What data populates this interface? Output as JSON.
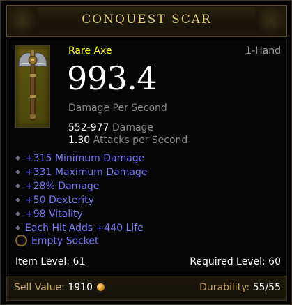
{
  "title": "CONQUEST SCAR",
  "item": {
    "type": "Rare Axe",
    "slot": "1-Hand",
    "icon": "axe-icon",
    "dps": "993.4",
    "dps_label": "Damage Per Second",
    "damage_value": "552-977",
    "damage_label": "Damage",
    "attacks_value": "1.30",
    "attacks_label": "Attacks per Second"
  },
  "affixes": [
    "+315 Minimum Damage",
    "+331 Maximum Damage",
    "+28% Damage",
    "+50 Dexterity",
    "+98 Vitality",
    "Each Hit Adds +440 Life"
  ],
  "socket": {
    "label": "Empty Socket"
  },
  "levels": {
    "item_level_label": "Item Level:",
    "item_level": "61",
    "required_level_label": "Required Level:",
    "required_level": "60"
  },
  "footer": {
    "sell_label": "Sell Value:",
    "sell_value": "1910",
    "durability_label": "Durability:",
    "durability_value": "55/55"
  },
  "colors": {
    "title": "#e6d06a",
    "rare": "#ffff00",
    "affix": "#7878ff",
    "muted": "#8a8a8a",
    "footer_label": "#c9a25a"
  }
}
